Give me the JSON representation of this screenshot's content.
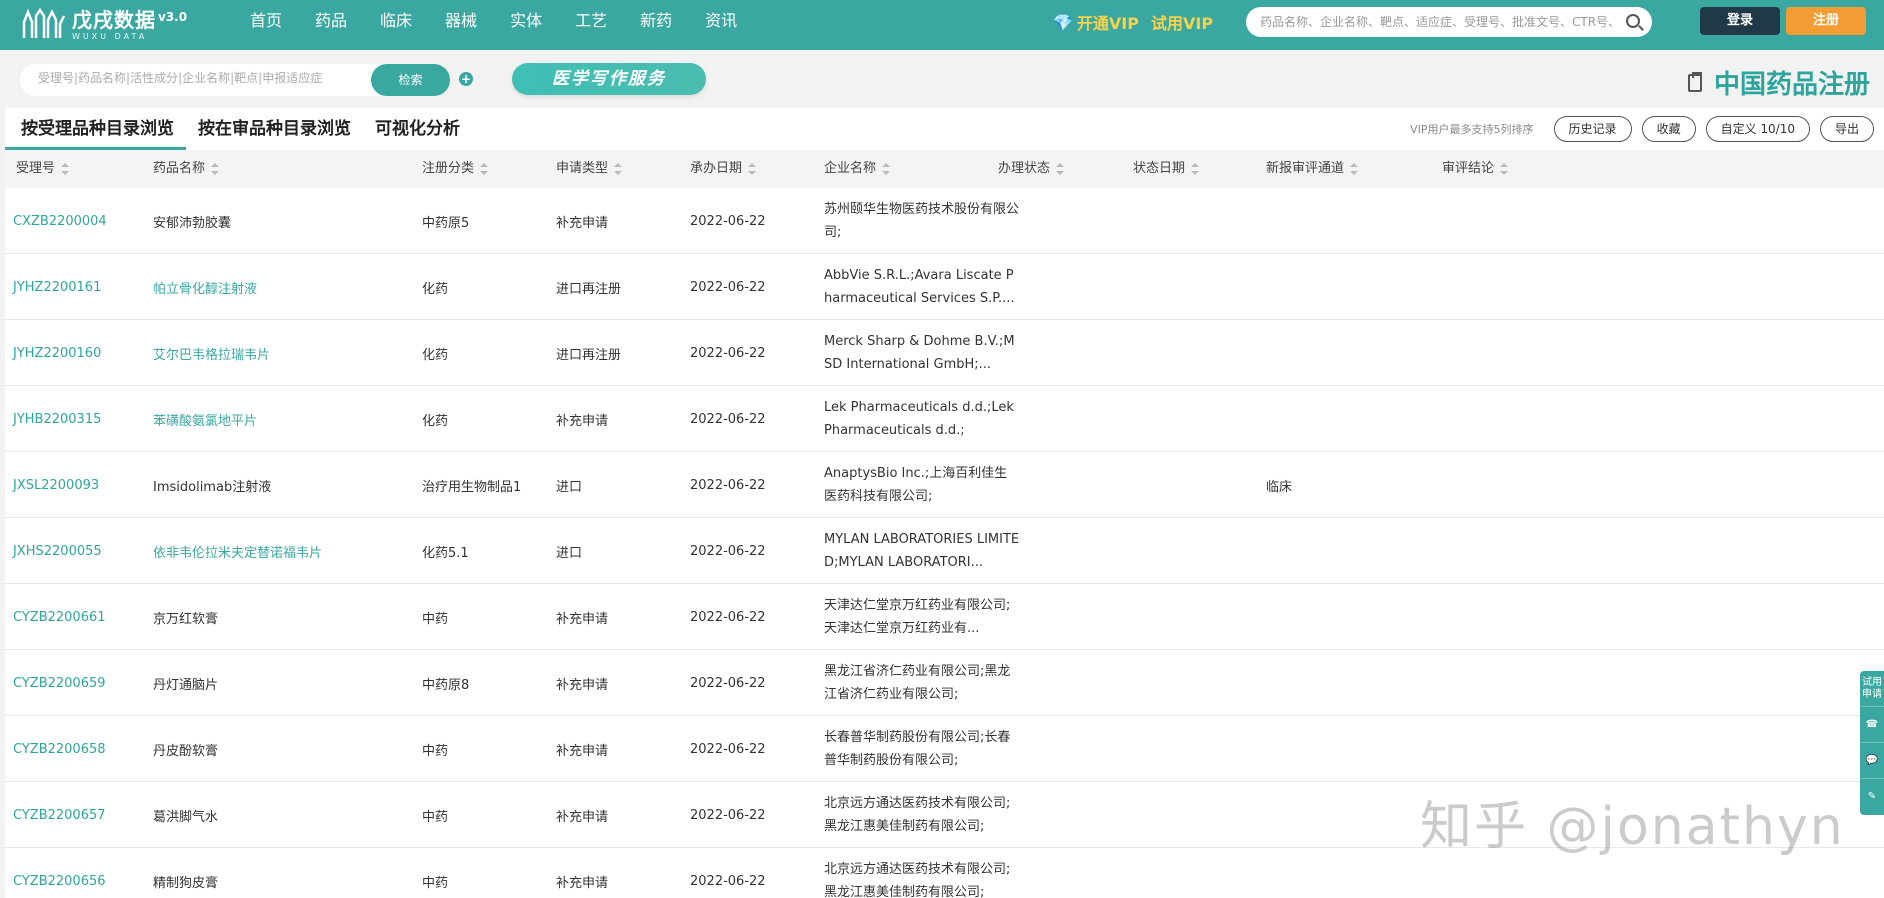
{
  "header": {
    "logo_name": "戊戌数据",
    "logo_sub": "WUXU DATA",
    "version": "v3.0",
    "nav": [
      "首页",
      "药品",
      "临床",
      "器械",
      "实体",
      "工艺",
      "新药",
      "资讯"
    ],
    "vip_open": "开通VIP",
    "vip_trial": "试用VIP",
    "search_placeholder": "药品名称、企业名称、靶点、适应症、受理号、批准文号、CTR号、NCT",
    "login": "登录",
    "register": "注册"
  },
  "subbar": {
    "search_placeholder": "受理号|药品名称|活性成分|企业名称|靶点|申报适应症",
    "search_button": "检索",
    "promo": "医学写作服务",
    "page_title": "中国药品注册"
  },
  "tabs": [
    "按受理品种目录浏览",
    "按在审品种目录浏览",
    "可视化分析"
  ],
  "actions": {
    "vip_note": "VIP用户最多支持5列排序",
    "history": "历史记录",
    "favorite": "收藏",
    "custom": "自定义 10/10",
    "export": "导出"
  },
  "columns": [
    "受理号",
    "药品名称",
    "注册分类",
    "申请类型",
    "承办日期",
    "企业名称",
    "办理状态",
    "状态日期",
    "新报审评通道",
    "审评结论"
  ],
  "rows": [
    {
      "id": "CXZB2200004",
      "name": "安郁沛勃胶囊",
      "name_link": false,
      "category": "中药原5",
      "type": "补充申请",
      "date": "2022-06-22",
      "company": "苏州颐华生物医药技术股份有限公司;",
      "status": "",
      "status_date": "",
      "channel": "",
      "conclusion": ""
    },
    {
      "id": "JYHZ2200161",
      "name": "帕立骨化醇注射液",
      "name_link": true,
      "category": "化药",
      "type": "进口再注册",
      "date": "2022-06-22",
      "company": "AbbVie S.R.L.;Avara Liscate Pharmaceutical Services S.P....",
      "status": "",
      "status_date": "",
      "channel": "",
      "conclusion": ""
    },
    {
      "id": "JYHZ2200160",
      "name": "艾尔巴韦格拉瑞韦片",
      "name_link": true,
      "category": "化药",
      "type": "进口再注册",
      "date": "2022-06-22",
      "company": "Merck Sharp & Dohme B.V.;MSD International GmbH;...",
      "status": "",
      "status_date": "",
      "channel": "",
      "conclusion": ""
    },
    {
      "id": "JYHB2200315",
      "name": "苯磺酸氨氯地平片",
      "name_link": true,
      "category": "化药",
      "type": "补充申请",
      "date": "2022-06-22",
      "company": "Lek Pharmaceuticals d.d.;Lek Pharmaceuticals d.d.;",
      "status": "",
      "status_date": "",
      "channel": "",
      "conclusion": ""
    },
    {
      "id": "JXSL2200093",
      "name": "Imsidolimab注射液",
      "name_link": false,
      "category": "治疗用生物制品1",
      "type": "进口",
      "date": "2022-06-22",
      "company": "AnaptysBio Inc.;上海百利佳生医药科技有限公司;",
      "status": "",
      "status_date": "",
      "channel": "临床",
      "conclusion": ""
    },
    {
      "id": "JXHS2200055",
      "name": "依非韦伦拉米夫定替诺福韦片",
      "name_link": true,
      "category": "化药5.1",
      "type": "进口",
      "date": "2022-06-22",
      "company": "MYLAN LABORATORIES LIMITED;MYLAN LABORATORI...",
      "status": "",
      "status_date": "",
      "channel": "",
      "conclusion": ""
    },
    {
      "id": "CYZB2200661",
      "name": "京万红软膏",
      "name_link": false,
      "category": "中药",
      "type": "补充申请",
      "date": "2022-06-22",
      "company": "天津达仁堂京万红药业有限公司;天津达仁堂京万红药业有...",
      "status": "",
      "status_date": "",
      "channel": "",
      "conclusion": ""
    },
    {
      "id": "CYZB2200659",
      "name": "丹灯通脑片",
      "name_link": false,
      "category": "中药原8",
      "type": "补充申请",
      "date": "2022-06-22",
      "company": "黑龙江省济仁药业有限公司;黑龙江省济仁药业有限公司;",
      "status": "",
      "status_date": "",
      "channel": "",
      "conclusion": ""
    },
    {
      "id": "CYZB2200658",
      "name": "丹皮酚软膏",
      "name_link": false,
      "category": "中药",
      "type": "补充申请",
      "date": "2022-06-22",
      "company": "长春普华制药股份有限公司;长春普华制药股份有限公司;",
      "status": "",
      "status_date": "",
      "channel": "",
      "conclusion": ""
    },
    {
      "id": "CYZB2200657",
      "name": "葛洪脚气水",
      "name_link": false,
      "category": "中药",
      "type": "补充申请",
      "date": "2022-06-22",
      "company": "北京远方通达医药技术有限公司;黑龙江惠美佳制药有限公司;",
      "status": "",
      "status_date": "",
      "channel": "",
      "conclusion": ""
    },
    {
      "id": "CYZB2200656",
      "name": "精制狗皮膏",
      "name_link": false,
      "category": "中药",
      "type": "补充申请",
      "date": "2022-06-22",
      "company": "北京远方通达医药技术有限公司;黑龙江惠美佳制药有限公司;",
      "status": "",
      "status_date": "",
      "channel": "",
      "conclusion": ""
    }
  ],
  "float": [
    "试用申请",
    "☎",
    "💬",
    "✎"
  ],
  "watermark": "知乎 @jonathyn"
}
